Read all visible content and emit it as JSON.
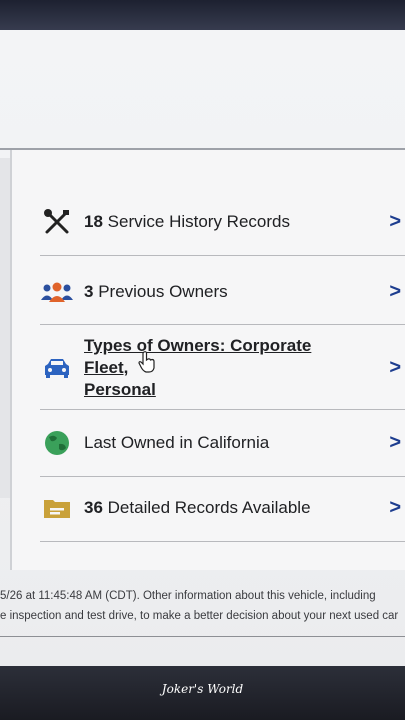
{
  "rows": [
    {
      "count": "18",
      "text": "Service History Records",
      "icon": "tools-icon"
    },
    {
      "count": "3",
      "text": "Previous Owners",
      "icon": "people-icon"
    },
    {
      "line1": "Types of Owners: Corporate Fleet,",
      "line2": "Personal",
      "icon": "car-icon"
    },
    {
      "text": "Last Owned in California",
      "icon": "globe-icon"
    },
    {
      "count": "36",
      "text": "Detailed Records Available",
      "icon": "folder-icon"
    }
  ],
  "chevron": ">",
  "footer": {
    "line1": "5/26 at 11:45:48 AM (CDT). Other information about this vehicle, including",
    "line2": "e inspection and test drive, to make a better decision about your next used car"
  },
  "watermark": "Joker's World",
  "colors": {
    "chevron": "#1d3d8f",
    "people_orange": "#e0632a",
    "people_blue": "#2b4f9e",
    "car_blue": "#2c63c0",
    "globe_green": "#3aa05a",
    "folder_gold": "#c9a13a"
  }
}
